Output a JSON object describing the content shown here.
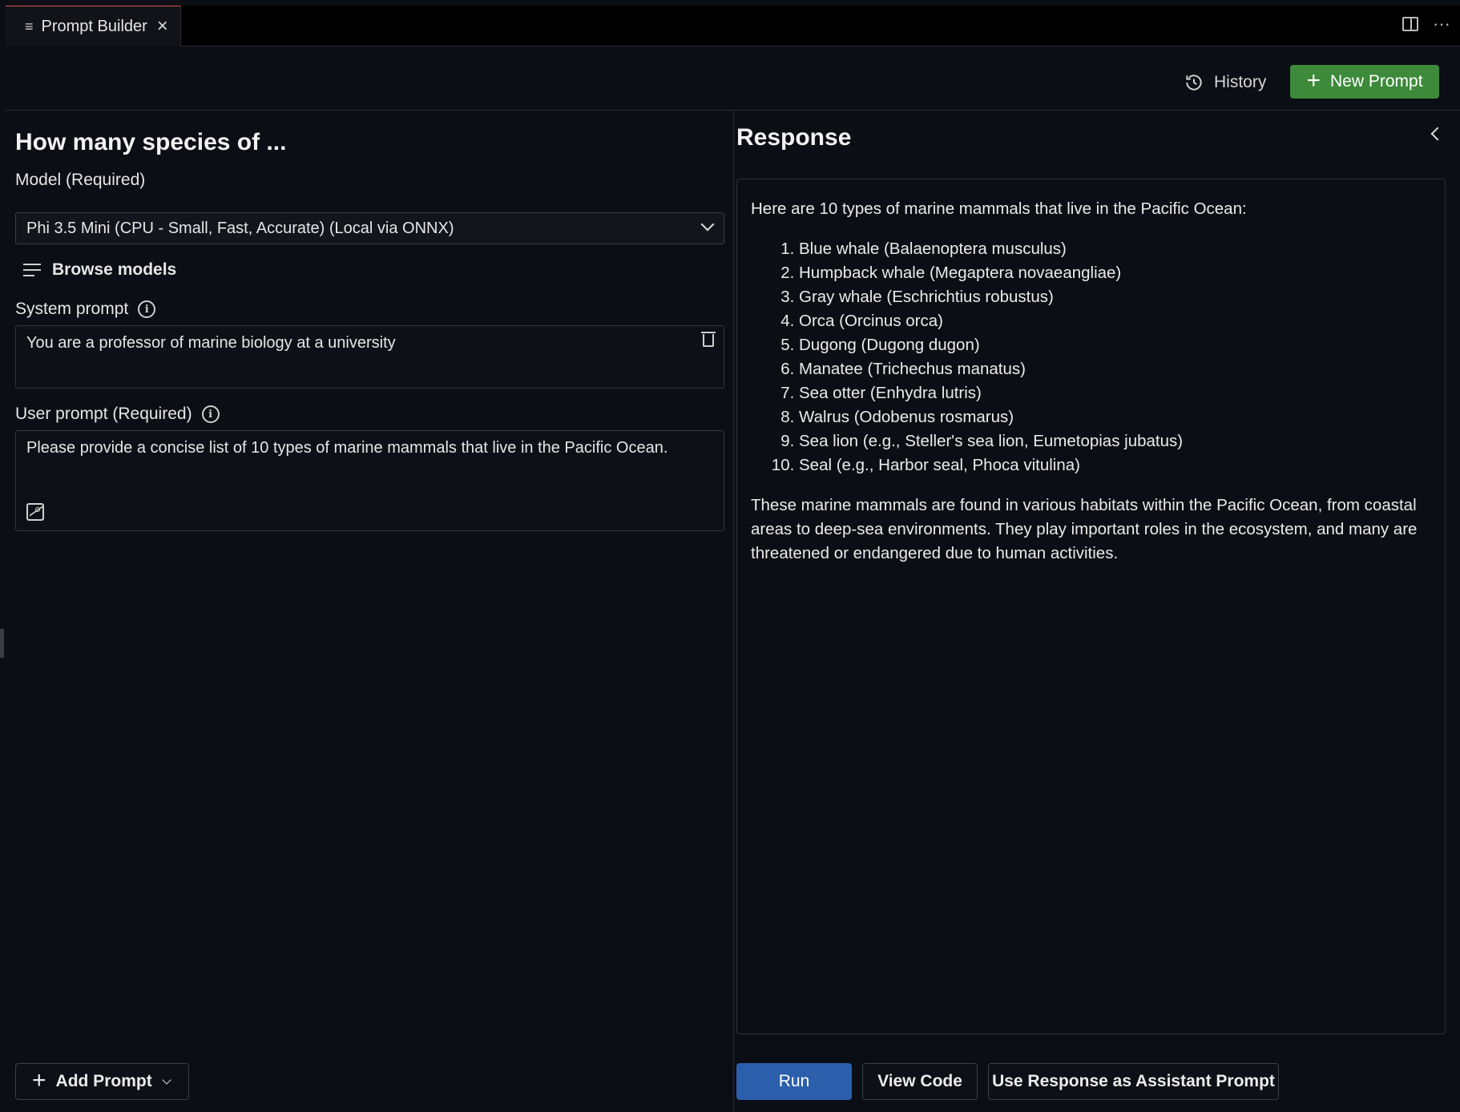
{
  "tab": {
    "icon": "list-icon",
    "label": "Prompt Builder",
    "close_icon": "close-icon"
  },
  "tabbar_actions": {
    "split_icon": "split-editor-icon",
    "more_label": "···"
  },
  "toolbar": {
    "history_label": "History",
    "history_icon": "history-icon",
    "new_prompt_label": "New Prompt",
    "new_prompt_icon": "plus-icon",
    "accent_color": "#3d8a3a"
  },
  "left": {
    "title": "How many species of ...",
    "model_label": "Model (Required)",
    "model_value": "Phi 3.5 Mini (CPU - Small, Fast, Accurate) (Local via ONNX)",
    "browse_models_label": "Browse models",
    "system_prompt_label": "System prompt",
    "system_prompt_value": "You are a professor of marine biology at a university",
    "user_prompt_label": "User prompt (Required)",
    "user_prompt_value": "Please provide a concise list of 10 types of marine mammals that live in the Pacific Ocean.",
    "add_prompt_label": "Add Prompt"
  },
  "right": {
    "title": "Response",
    "intro": "Here are 10 types of marine mammals that live in the Pacific Ocean:",
    "items": [
      "Blue whale (Balaenoptera musculus)",
      "Humpback whale (Megaptera novaeangliae)",
      "Gray whale (Eschrichtius robustus)",
      "Orca (Orcinus orca)",
      "Dugong (Dugong dugon)",
      "Manatee (Trichechus manatus)",
      "Sea otter (Enhydra lutris)",
      "Walrus (Odobenus rosmarus)",
      "Sea lion (e.g., Steller's sea lion, Eumetopias jubatus)",
      "Seal (e.g., Harbor seal, Phoca vitulina)"
    ],
    "conclusion": "These marine mammals are found in various habitats within the Pacific Ocean, from coastal areas to deep-sea environments. They play important roles in the ecosystem, and many are threatened or endangered due to human activities.",
    "run_label": "Run",
    "view_code_label": "View Code",
    "use_response_label": "Use Response as Assistant Prompt",
    "run_color": "#2b5fac"
  }
}
